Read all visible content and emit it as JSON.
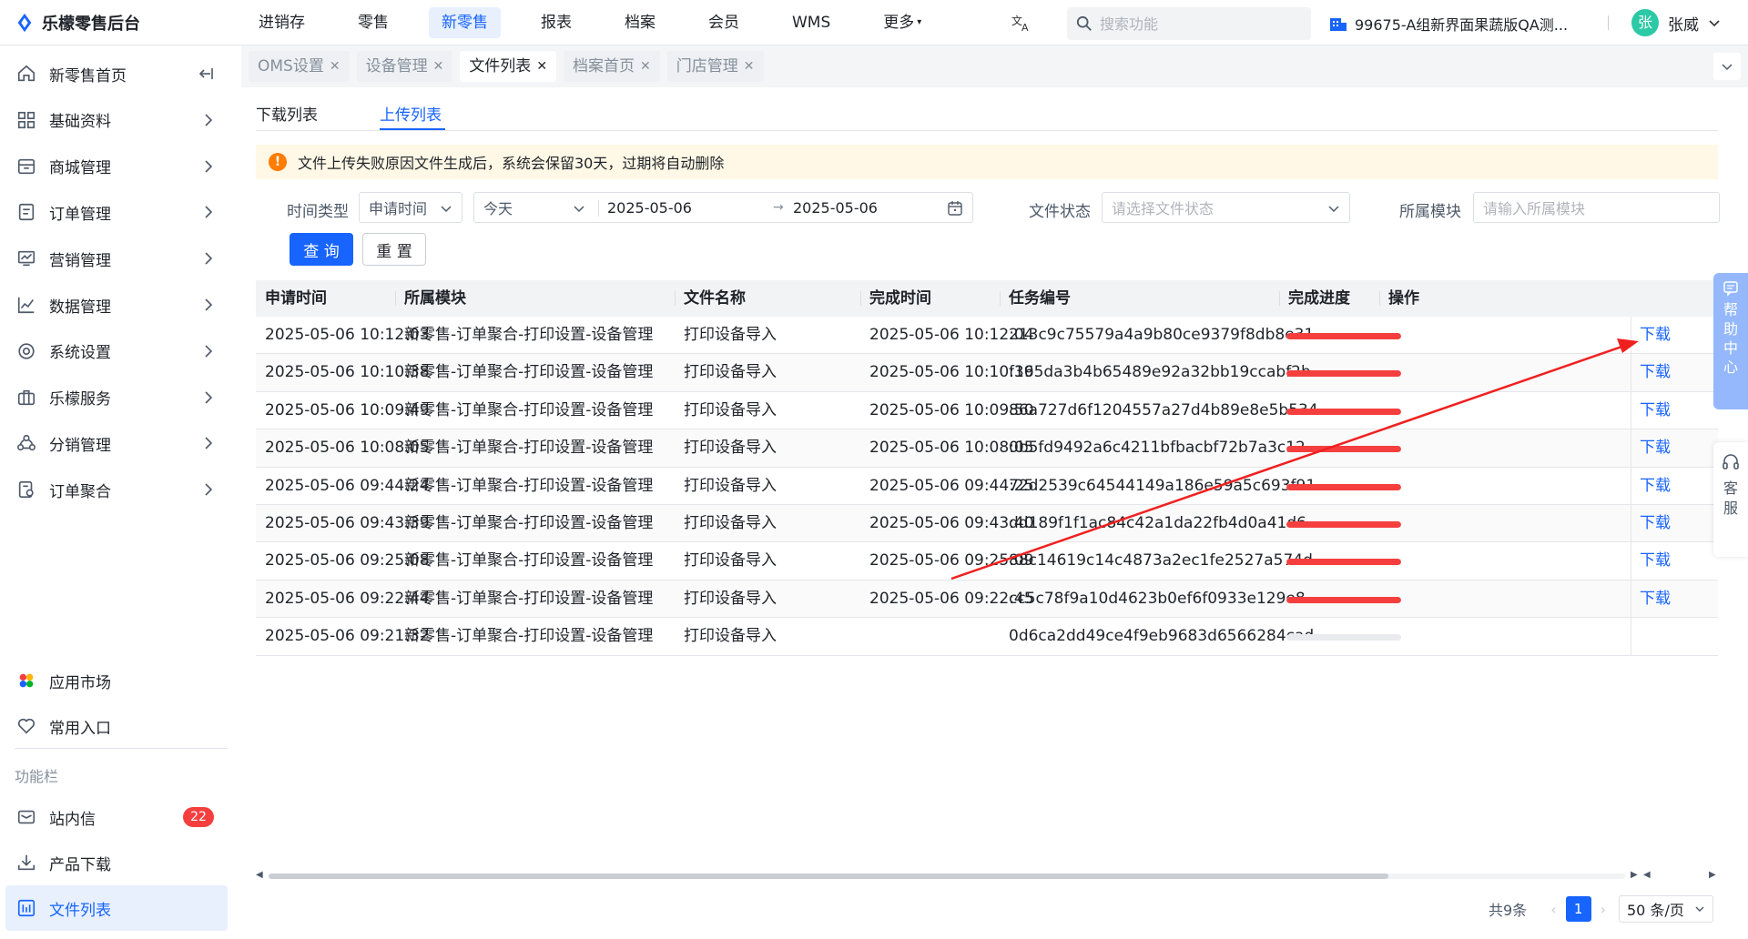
{
  "app": {
    "title": "乐檬零售后台"
  },
  "topnav": [
    {
      "label": "进销存",
      "active": false
    },
    {
      "label": "零售",
      "active": false
    },
    {
      "label": "新零售",
      "active": true
    },
    {
      "label": "报表",
      "active": false
    },
    {
      "label": "档案",
      "active": false
    },
    {
      "label": "会员",
      "active": false
    },
    {
      "label": "WMS",
      "active": false
    },
    {
      "label": "更多",
      "active": false
    }
  ],
  "header": {
    "search_placeholder": "搜索功能",
    "store": "99675-A组新界面果蔬版QA测...",
    "user_initial": "张",
    "user_name": "张威"
  },
  "sidebar": {
    "items": [
      {
        "label": "新零售首页",
        "icon": "home-icon"
      },
      {
        "label": "基础资料",
        "icon": "grid-icon"
      },
      {
        "label": "商城管理",
        "icon": "store-icon"
      },
      {
        "label": "订单管理",
        "icon": "order-icon"
      },
      {
        "label": "营销管理",
        "icon": "marketing-icon"
      },
      {
        "label": "数据管理",
        "icon": "chart-icon"
      },
      {
        "label": "系统设置",
        "icon": "settings-icon"
      },
      {
        "label": "乐檬服务",
        "icon": "briefcase-icon"
      },
      {
        "label": "分销管理",
        "icon": "distribution-icon"
      },
      {
        "label": "订单聚合",
        "icon": "aggregate-icon"
      }
    ],
    "bottom": [
      {
        "label": "应用市场",
        "icon": "app-market-icon"
      },
      {
        "label": "常用入口",
        "icon": "heart-icon"
      }
    ],
    "group_label": "功能栏",
    "func": [
      {
        "label": "站内信",
        "icon": "mail-icon",
        "badge": "22"
      },
      {
        "label": "产品下载",
        "icon": "download-icon"
      },
      {
        "label": "文件列表",
        "icon": "file-list-icon",
        "active": true
      }
    ]
  },
  "tabs": [
    {
      "label": "OMS设置",
      "active": false
    },
    {
      "label": "设备管理",
      "active": false
    },
    {
      "label": "文件列表",
      "active": true
    },
    {
      "label": "档案首页",
      "active": false
    },
    {
      "label": "门店管理",
      "active": false
    }
  ],
  "subtabs": {
    "download": "下载列表",
    "upload": "上传列表"
  },
  "notice": "文件上传失败原因文件生成后，系统会保留30天，过期将自动删除",
  "filters": {
    "time_type_label": "时间类型",
    "time_type_value": "申请时间",
    "range_value": "今天",
    "date_start": "2025-05-06",
    "date_end": "2025-05-06",
    "status_label": "文件状态",
    "status_placeholder": "请选择文件状态",
    "module_label": "所属模块",
    "module_placeholder": "请输入所属模块",
    "query_button": "查 询",
    "reset_button": "重 置"
  },
  "table": {
    "columns": [
      "申请时间",
      "所属模块",
      "文件名称",
      "完成时间",
      "任务编号",
      "完成进度",
      "操作"
    ],
    "action_label": "下载",
    "rows": [
      {
        "apply": "2025-05-06 10:12:03",
        "module": "新零售-订单聚合-打印设置-设备管理",
        "name": "打印设备导入",
        "done": "2025-05-06 10:12:04",
        "task": "213c9c75579a4a9b80ce9379f8db8e31",
        "progress": 100,
        "action": true
      },
      {
        "apply": "2025-05-06 10:10:38",
        "module": "新零售-订单聚合-打印设置-设备管理",
        "name": "打印设备导入",
        "done": "2025-05-06 10:10:39",
        "task": "f165da3b4b65489e92a32bb19ccabf2b",
        "progress": 100,
        "action": true
      },
      {
        "apply": "2025-05-06 10:09:49",
        "module": "新零售-订单聚合-打印设置-设备管理",
        "name": "打印设备导入",
        "done": "2025-05-06 10:09:50",
        "task": "86a727d6f1204557a27d4b89e8e5b534",
        "progress": 100,
        "action": true
      },
      {
        "apply": "2025-05-06 10:08:05",
        "module": "新零售-订单聚合-打印设置-设备管理",
        "name": "打印设备导入",
        "done": "2025-05-06 10:08:05",
        "task": "0b5fd9492a6c4211bfbacbf72b7a3c12",
        "progress": 100,
        "action": true
      },
      {
        "apply": "2025-05-06 09:44:24",
        "module": "新零售-订单聚合-打印设置-设备管理",
        "name": "打印设备导入",
        "done": "2025-05-06 09:44:25",
        "task": "72d2539c64544149a186e59a5c693f91",
        "progress": 100,
        "action": true
      },
      {
        "apply": "2025-05-06 09:43:39",
        "module": "新零售-订单聚合-打印设置-设备管理",
        "name": "打印设备导入",
        "done": "2025-05-06 09:43:40",
        "task": "dd189f1f1ac84c42a1da22fb4d0a41d6",
        "progress": 100,
        "action": true
      },
      {
        "apply": "2025-05-06 09:25:08",
        "module": "新零售-订单聚合-打印设置-设备管理",
        "name": "打印设备导入",
        "done": "2025-05-06 09:25:09",
        "task": "88c14619c14c4873a2ec1fe2527a574d",
        "progress": 100,
        "action": true
      },
      {
        "apply": "2025-05-06 09:22:44",
        "module": "新零售-订单聚合-打印设置-设备管理",
        "name": "打印设备导入",
        "done": "2025-05-06 09:22:45",
        "task": "cc5c78f9a10d4623b0ef6f0933e129e8",
        "progress": 100,
        "action": true
      },
      {
        "apply": "2025-05-06 09:21:32",
        "module": "新零售-订单聚合-打印设置-设备管理",
        "name": "打印设备导入",
        "done": "",
        "task": "0d6ca2dd49ce4f9eb9683d6566284cad",
        "progress": 0,
        "action": false
      }
    ]
  },
  "pager": {
    "total": "共9条",
    "current": "1",
    "size": "50 条/页"
  },
  "float": {
    "help": [
      "帮",
      "助",
      "中",
      "心"
    ],
    "service": [
      "客",
      "服"
    ]
  },
  "colors": {
    "primary": "#1764ff",
    "progress": "#f53f3f",
    "warning": "#ff7d00",
    "annotation": "#f02020"
  }
}
